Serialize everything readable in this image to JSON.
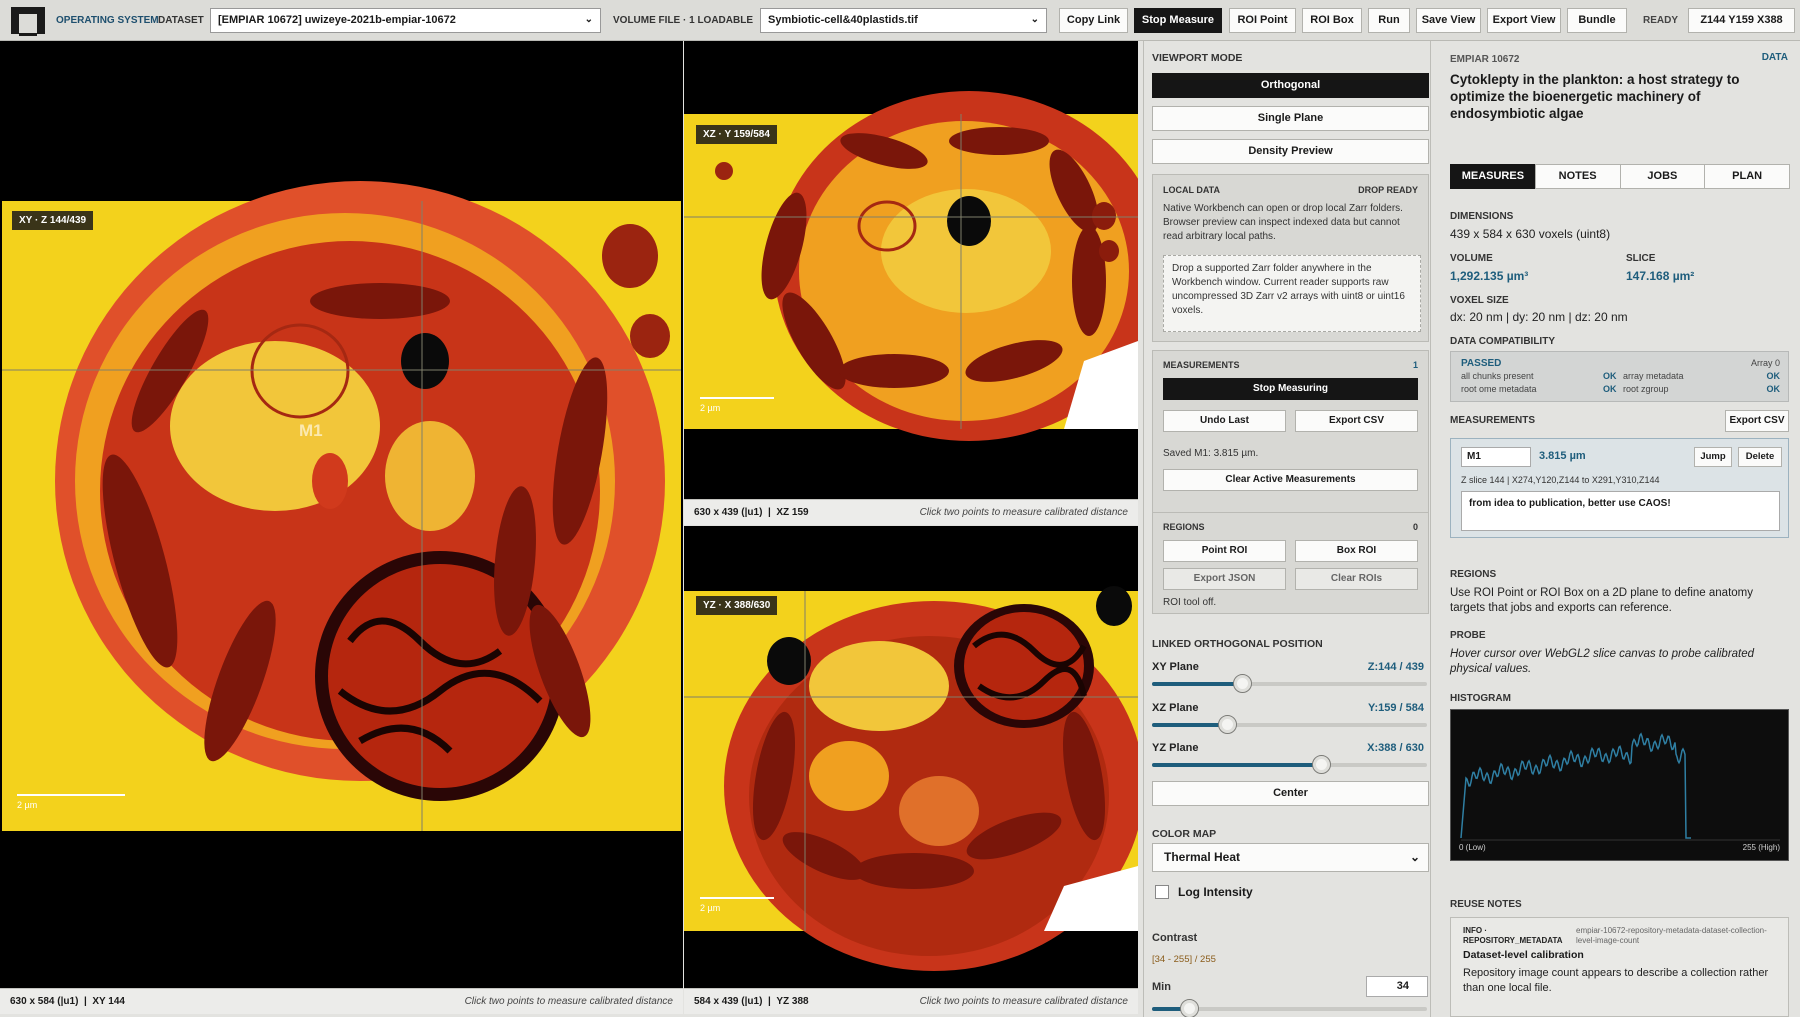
{
  "topbar": {
    "os_label": "OPERATING SYSTEM",
    "dataset_label": "DATASET",
    "dataset_value": "[EMPIAR 10672] uwizeye-2021b-empiar-10672",
    "volume_label": "VOLUME FILE · 1 LOADABLE",
    "volume_value": "Symbiotic-cell&40plastids.tif",
    "buttons": [
      "Copy Link",
      "Stop Measure",
      "ROI Point",
      "ROI Box",
      "Run",
      "Save View",
      "Export View",
      "Bundle"
    ],
    "status": "READY",
    "coords": "Z144 Y159 X388"
  },
  "viewports": {
    "xy": {
      "tag": "XY · Z 144/439",
      "dims": "630 x 584 (|u1)",
      "plane": "XY 144",
      "hint": "Click two points to measure calibrated distance",
      "label": "M1",
      "scale": "2 µm"
    },
    "xz": {
      "tag": "XZ · Y 159/584",
      "dims": "630 x 439 (|u1)",
      "plane": "XZ 159",
      "hint": "Click two points to measure calibrated distance",
      "scale": "2 µm"
    },
    "yz": {
      "tag": "YZ · X 388/630",
      "dims": "584 x 439 (|u1)",
      "plane": "YZ 388",
      "hint": "Click two points to measure calibrated distance",
      "scale": "2 µm"
    }
  },
  "mid": {
    "viewport_mode_title": "VIEWPORT MODE",
    "modes": [
      "Orthogonal",
      "Single Plane",
      "Density Preview"
    ],
    "local_data": {
      "title": "LOCAL DATA",
      "status": "DROP READY",
      "desc": "Native Workbench can open or drop local Zarr folders. Browser preview can inspect indexed data but cannot read arbitrary local paths.",
      "drop": "Drop a supported Zarr folder anywhere in the Workbench window. Current reader supports raw uncompressed 3D Zarr v2 arrays with uint8 or uint16 voxels."
    },
    "measurements": {
      "title": "MEASUREMENTS",
      "count": "1",
      "stop": "Stop Measuring",
      "undo": "Undo Last",
      "export": "Export CSV",
      "saved": "Saved M1: 3.815 µm.",
      "clear": "Clear Active Measurements"
    },
    "regions": {
      "title": "REGIONS",
      "count": "0",
      "point": "Point ROI",
      "box": "Box ROI",
      "export_json": "Export JSON",
      "clear": "Clear ROIs",
      "status": "ROI tool off."
    },
    "linked": {
      "title": "LINKED ORTHOGONAL POSITION",
      "planes": [
        {
          "name": "XY Plane",
          "value": "Z:144 / 439",
          "fraction": 0.328
        },
        {
          "name": "XZ Plane",
          "value": "Y:159 / 584",
          "fraction": 0.272
        },
        {
          "name": "YZ Plane",
          "value": "X:388 / 630",
          "fraction": 0.616
        }
      ],
      "center": "Center"
    },
    "color_map": {
      "title": "COLOR MAP",
      "value": "Thermal Heat",
      "log_label": "Log Intensity",
      "contrast_label": "Contrast",
      "contrast_range": "[34 - 255] / 255",
      "min_label": "Min",
      "min_value": "34",
      "min_fraction": 0.133
    }
  },
  "right": {
    "dataset_id": "EMPIAR 10672",
    "data_link": "DATA",
    "title": "Cytoklepty in the plankton: a host strategy to optimize the bioenergetic machinery of endosymbiotic algae",
    "tabs": [
      "MEASURES",
      "NOTES",
      "JOBS",
      "PLAN"
    ],
    "dimensions_label": "DIMENSIONS",
    "dimensions": "439 x 584 x 630 voxels (uint8)",
    "volume_label": "VOLUME",
    "volume": "1,292.135 µm³",
    "slice_label": "SLICE",
    "slice": "147.168 µm²",
    "voxel_label": "VOXEL SIZE",
    "voxel": "dx: 20 nm | dy: 20 nm | dz: 20 nm",
    "compat_label": "DATA COMPATIBILITY",
    "compat": {
      "status": "PASSED",
      "array": "Array 0",
      "rows": [
        {
          "name": "all chunks present",
          "value": "OK"
        },
        {
          "name": "array metadata",
          "value": "OK"
        },
        {
          "name": "root ome metadata",
          "value": "OK"
        },
        {
          "name": "root zgroup",
          "value": "OK"
        }
      ]
    },
    "measurements_label": "MEASUREMENTS",
    "export_csv": "Export CSV",
    "m1": {
      "name": "M1",
      "value": "3.815 µm",
      "jump": "Jump",
      "delete": "Delete",
      "detail": "Z slice 144 | X274,Y120,Z144 to X291,Y310,Z144",
      "note": "from idea to publication, better use CAOS!"
    },
    "regions_label": "REGIONS",
    "regions_text": "Use ROI Point or ROI Box on a 2D plane to define anatomy targets that jobs and exports can reference.",
    "probe_label": "PROBE",
    "probe_text": "Hover cursor over WebGL2 slice canvas to probe calibrated physical values.",
    "histogram_label": "HISTOGRAM",
    "hist_low": "0 (Low)",
    "hist_high": "255 (High)",
    "reuse_label": "REUSE NOTES",
    "reuse": {
      "tag": "INFO · REPOSITORY_METADATA",
      "key": "empiar-10672-repository-metadata-dataset-collection-level-image-count",
      "title": "Dataset-level calibration",
      "text": "Repository image count appears to describe a collection rather than one local file."
    }
  }
}
